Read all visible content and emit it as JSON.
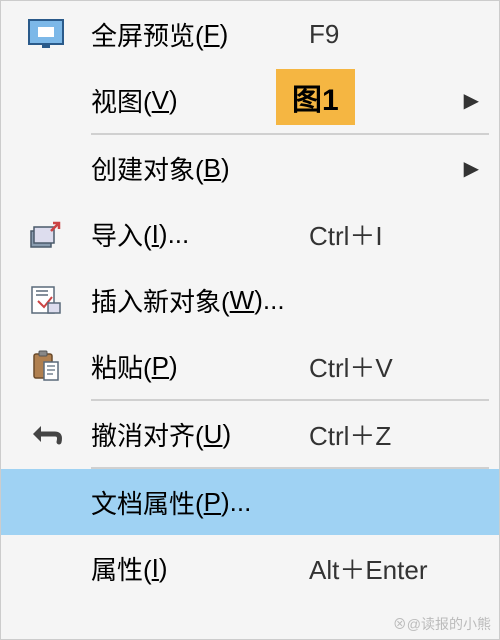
{
  "badge": "图1",
  "menu": {
    "items": [
      {
        "label_pre": "全屏预览(",
        "hotkey": "F",
        "label_post": ")",
        "shortcut": "F9",
        "submenu": false,
        "icon": "fullscreen"
      },
      {
        "label_pre": "视图(",
        "hotkey": "V",
        "label_post": ")",
        "shortcut": "",
        "submenu": true,
        "icon": ""
      },
      {
        "sep": true
      },
      {
        "label_pre": "创建对象(",
        "hotkey": "B",
        "label_post": ")",
        "shortcut": "",
        "submenu": true,
        "icon": ""
      },
      {
        "label_pre": "导入(",
        "hotkey": "I",
        "label_post": ")...",
        "shortcut": "Ctrl＋I",
        "submenu": false,
        "icon": "import"
      },
      {
        "label_pre": "插入新对象(",
        "hotkey": "W",
        "label_post": ")...",
        "shortcut": "",
        "submenu": false,
        "icon": "insert"
      },
      {
        "label_pre": "粘贴(",
        "hotkey": "P",
        "label_post": ")",
        "shortcut": "Ctrl＋V",
        "submenu": false,
        "icon": "paste"
      },
      {
        "sep": true
      },
      {
        "label_pre": "撤消对齐(",
        "hotkey": "U",
        "label_post": ")",
        "shortcut": "Ctrl＋Z",
        "submenu": false,
        "icon": "undo"
      },
      {
        "sep": true
      },
      {
        "label_pre": "文档属性(",
        "hotkey": "P",
        "label_post": ")...",
        "shortcut": "",
        "submenu": false,
        "icon": "",
        "highlighted": true
      },
      {
        "label_pre": "属性(",
        "hotkey": "I",
        "label_post": ")",
        "shortcut": "Alt＋Enter",
        "submenu": false,
        "icon": ""
      }
    ]
  },
  "watermark": "⊗@读报的小熊"
}
